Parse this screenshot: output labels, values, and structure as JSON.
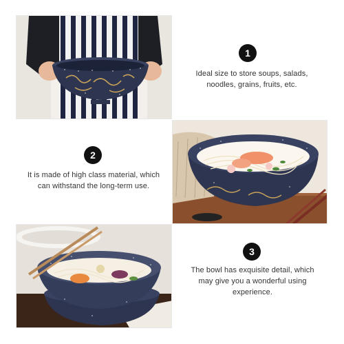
{
  "sections": [
    {
      "number": "1",
      "text": "Ideal size to store soups, salads, noodles, grains, fruits, etc."
    },
    {
      "number": "2",
      "text": "It is made of high class material, which can withstand the long-term use."
    },
    {
      "number": "3",
      "text": "The bowl has exquisite detail, which may give you a wonderful using experience."
    }
  ],
  "icons": {
    "photo1": "person-holding-bowl-photo",
    "photo2": "noodle-soup-bowl-photo",
    "photo3": "stacked-bowls-with-chopsticks-photo"
  },
  "colors": {
    "badge": "#111111",
    "bowl": "#2d3550",
    "speckle": "#d9d9d9"
  }
}
